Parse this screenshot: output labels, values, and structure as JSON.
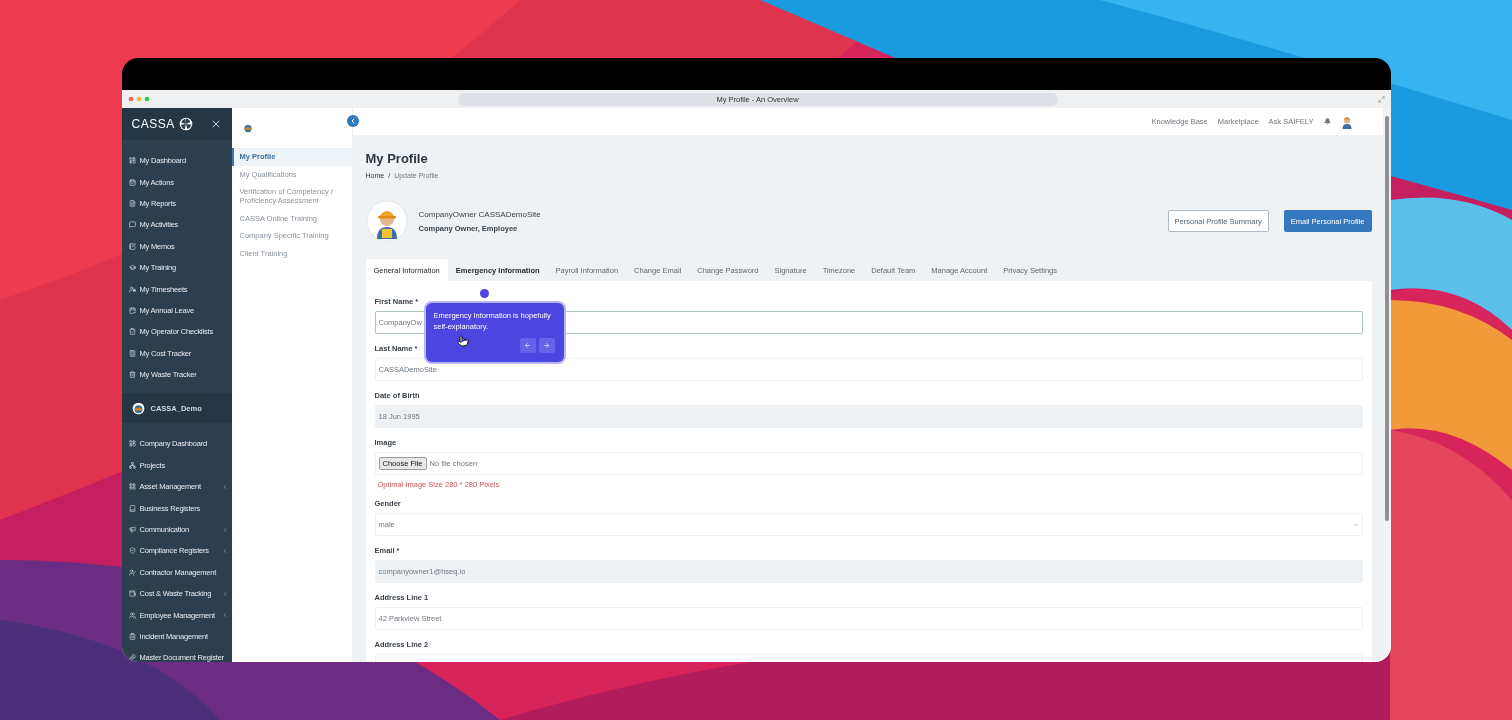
{
  "window": {
    "title": "My Profile - An Overview"
  },
  "sidebar": {
    "brand": "CASSA",
    "items": [
      {
        "label": "My Dashboard",
        "has_submenu": false
      },
      {
        "label": "My Actions",
        "has_submenu": false
      },
      {
        "label": "My Reports",
        "has_submenu": false
      },
      {
        "label": "My Activities",
        "has_submenu": false
      },
      {
        "label": "My Memos",
        "has_submenu": false
      },
      {
        "label": "My Training",
        "has_submenu": false
      },
      {
        "label": "My Timesheets",
        "has_submenu": false
      },
      {
        "label": "My Annual Leave",
        "has_submenu": false
      },
      {
        "label": "My Operator Checklists",
        "has_submenu": false
      },
      {
        "label": "My Cost Tracker",
        "has_submenu": false
      },
      {
        "label": "My Waste Tracker",
        "has_submenu": false
      }
    ],
    "company": "CASSA_Demo",
    "company_items": [
      {
        "label": "Company Dashboard",
        "has_submenu": false
      },
      {
        "label": "Projects",
        "has_submenu": false
      },
      {
        "label": "Asset Management",
        "has_submenu": true
      },
      {
        "label": "Business Registers",
        "has_submenu": false
      },
      {
        "label": "Communication",
        "has_submenu": true
      },
      {
        "label": "Compliance Registers",
        "has_submenu": true
      },
      {
        "label": "Contractor Management",
        "has_submenu": false
      },
      {
        "label": "Cost & Waste Tracking",
        "has_submenu": true
      },
      {
        "label": "Employee Management",
        "has_submenu": true
      },
      {
        "label": "Incident Management",
        "has_submenu": false
      },
      {
        "label": "Master Document Register",
        "has_submenu": false
      }
    ]
  },
  "subnav": {
    "items": [
      {
        "label": "My Profile",
        "selected": true
      },
      {
        "label": "My Qualifications",
        "selected": false
      },
      {
        "label": "Verification of Competency / Proficiency Assessment",
        "selected": false
      },
      {
        "label": "CASSA Online Training",
        "selected": false
      },
      {
        "label": "Company Specific Training",
        "selected": false
      },
      {
        "label": "Client Training",
        "selected": false
      }
    ]
  },
  "topbar": {
    "links": [
      "Knowledge Base",
      "Marketplace",
      "Ask SAIFELY"
    ]
  },
  "page": {
    "title": "My Profile",
    "breadcrumb": {
      "items": [
        "Home",
        "Update Profile"
      ],
      "separator": "/"
    }
  },
  "profile": {
    "name": "CompanyOwner CASSADemoSite",
    "roles": "Company Owner, Employee",
    "buttons": [
      {
        "label": "Personal Profile Summary",
        "kind": "outline"
      },
      {
        "label": "Email Personal Profile",
        "kind": "primary"
      }
    ]
  },
  "tabs": [
    {
      "label": "General Information",
      "selected": true,
      "highlighted": false
    },
    {
      "label": "Emergency Information",
      "selected": false,
      "highlighted": true
    },
    {
      "label": "Payroll Information",
      "selected": false,
      "highlighted": false
    },
    {
      "label": "Change Email",
      "selected": false,
      "highlighted": false
    },
    {
      "label": "Change Password",
      "selected": false,
      "highlighted": false
    },
    {
      "label": "Signature",
      "selected": false,
      "highlighted": false
    },
    {
      "label": "Timezone",
      "selected": false,
      "highlighted": false
    },
    {
      "label": "Default Team",
      "selected": false,
      "highlighted": false
    },
    {
      "label": "Manage Account",
      "selected": false,
      "highlighted": false
    },
    {
      "label": "Privacy Settings",
      "selected": false,
      "highlighted": false
    }
  ],
  "form": {
    "fields": [
      {
        "kind": "text",
        "label": "First Name *",
        "value": "CompanyOw",
        "disabled": false,
        "focused": true
      },
      {
        "kind": "text",
        "label": "Last Name *",
        "value": "CASSADemoSite",
        "disabled": false,
        "focused": false
      },
      {
        "kind": "text",
        "label": "Date of Birth",
        "value": "18 Jun 1995",
        "disabled": true,
        "focused": false
      },
      {
        "kind": "file",
        "label": "Image",
        "button": "Choose File",
        "value": "No file chosen",
        "hint": "Optimal Image Size 280 * 280 Pixels"
      },
      {
        "kind": "select",
        "label": "Gender",
        "value": "male",
        "disabled": false,
        "focused": false
      },
      {
        "kind": "text",
        "label": "Email *",
        "value": "companyowner1@hseq.io",
        "disabled": true,
        "focused": false
      },
      {
        "kind": "text",
        "label": "Address Line 1",
        "value": "42 Parkview Street",
        "disabled": false,
        "focused": false
      },
      {
        "kind": "text",
        "label": "Address Line 2"
      }
    ]
  },
  "tour": {
    "text": "Emergency Information is hopefully self-explanatory."
  }
}
